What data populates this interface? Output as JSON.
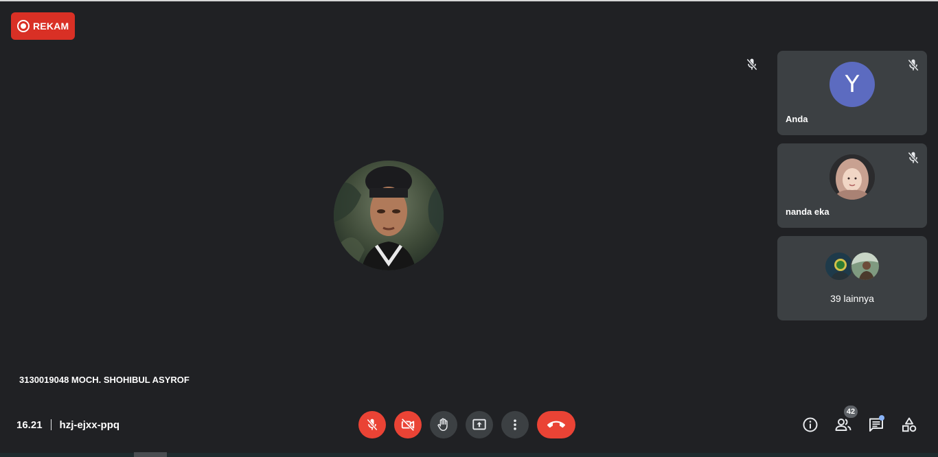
{
  "recording": {
    "label": "REKAM",
    "color": "#d93025"
  },
  "main": {
    "speaker_name": "3130019048 MOCH. SHOHIBUL ASYROF",
    "mic_status_icon": "mic-off-icon"
  },
  "participants": [
    {
      "name": "Anda",
      "initial": "Y",
      "avatar_color": "#5c6bc0",
      "muted": true
    },
    {
      "name": "nanda eka",
      "muted": true
    },
    {
      "others_label": "39 lainnya"
    }
  ],
  "bottom": {
    "time": "16.21",
    "meeting_code": "hzj-ejxx-ppq",
    "participant_count": "42"
  },
  "controls": [
    {
      "name": "mic-off-icon",
      "state": "off"
    },
    {
      "name": "camera-off-icon",
      "state": "off"
    },
    {
      "name": "raise-hand-icon"
    },
    {
      "name": "present-screen-icon"
    },
    {
      "name": "more-options-icon"
    },
    {
      "name": "end-call-icon"
    }
  ],
  "right_controls": [
    "info-icon",
    "people-icon",
    "chat-icon",
    "activities-icon"
  ],
  "colors": {
    "background": "#202124",
    "tile": "#3c4043",
    "danger": "#ea4335",
    "accent": "#8ab4f8"
  }
}
